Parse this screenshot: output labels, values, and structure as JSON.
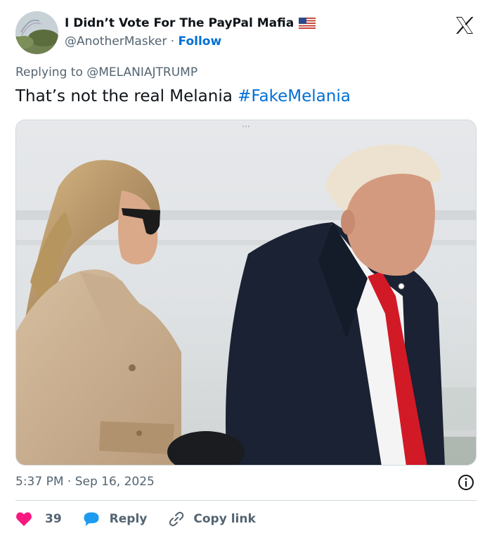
{
  "author": {
    "display_name": "I Didn’t Vote For The PayPal Mafia",
    "handle": "@AnotherMasker",
    "separator": " · ",
    "follow_label": "Follow",
    "flag_icon": "us-flag-icon"
  },
  "brand": {
    "logo_icon": "x-logo-icon"
  },
  "reply": {
    "prefix": "Replying to ",
    "target": "@MELANIAJTRUMP"
  },
  "tweet": {
    "text": "That’s not the real Melania ",
    "hashtag": "#FakeMelania"
  },
  "media": {
    "more_label": "···"
  },
  "meta": {
    "timestamp": "5:37 PM · Sep 16, 2025"
  },
  "actions": {
    "like_count": "39",
    "reply_label": "Reply",
    "copy_label": "Copy link"
  },
  "colors": {
    "link": "#006fd6",
    "like": "#f91880",
    "reply_bubble": "#1d9bf0",
    "muted": "#536471"
  }
}
